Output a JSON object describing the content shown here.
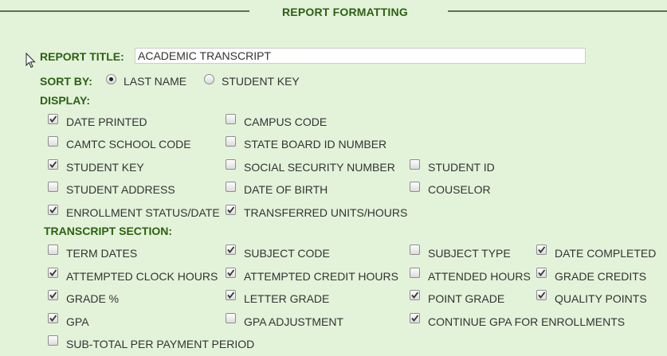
{
  "section_title": "REPORT FORMATTING",
  "report_title": {
    "label": "REPORT TITLE:",
    "value": "ACADEMIC TRANSCRIPT"
  },
  "sort_by": {
    "label": "SORT BY:",
    "options": [
      {
        "label": "LAST NAME",
        "selected": true
      },
      {
        "label": "STUDENT KEY",
        "selected": false
      }
    ]
  },
  "display": {
    "label": "DISPLAY:",
    "items": [
      {
        "label": "DATE PRINTED",
        "checked": true
      },
      {
        "label": "CAMPUS CODE",
        "checked": false
      },
      {
        "label": "CAMTC SCHOOL CODE",
        "checked": false
      },
      {
        "label": "STATE BOARD ID NUMBER",
        "checked": false
      },
      {
        "label": "STUDENT KEY",
        "checked": true
      },
      {
        "label": "SOCIAL SECURITY NUMBER",
        "checked": false
      },
      {
        "label": "STUDENT ID",
        "checked": false
      },
      {
        "label": "STUDENT ADDRESS",
        "checked": false
      },
      {
        "label": "DATE OF BIRTH",
        "checked": false
      },
      {
        "label": "COUSELOR",
        "checked": false
      },
      {
        "label": "ENROLLMENT STATUS/DATE",
        "checked": true
      },
      {
        "label": "TRANSFERRED UNITS/HOURS",
        "checked": true
      }
    ]
  },
  "transcript": {
    "label": "TRANSCRIPT SECTION:",
    "items": [
      {
        "label": "TERM DATES",
        "checked": false
      },
      {
        "label": "SUBJECT CODE",
        "checked": true
      },
      {
        "label": "SUBJECT TYPE",
        "checked": false
      },
      {
        "label": "DATE COMPLETED",
        "checked": true
      },
      {
        "label": "ATTEMPTED CLOCK HOURS",
        "checked": true
      },
      {
        "label": "ATTEMPTED CREDIT HOURS",
        "checked": true
      },
      {
        "label": "ATTENDED HOURS",
        "checked": false
      },
      {
        "label": "GRADE CREDITS",
        "checked": true
      },
      {
        "label": "GRADE %",
        "checked": true
      },
      {
        "label": "LETTER GRADE",
        "checked": true
      },
      {
        "label": "POINT GRADE",
        "checked": true
      },
      {
        "label": "QUALITY POINTS",
        "checked": true
      },
      {
        "label": "GPA",
        "checked": true
      },
      {
        "label": "GPA ADJUSTMENT",
        "checked": false
      },
      {
        "label": "CONTINUE GPA FOR ENROLLMENTS",
        "checked": true
      },
      {
        "label": "SUB-TOTAL PER PAYMENT PERIOD",
        "checked": false
      }
    ]
  }
}
